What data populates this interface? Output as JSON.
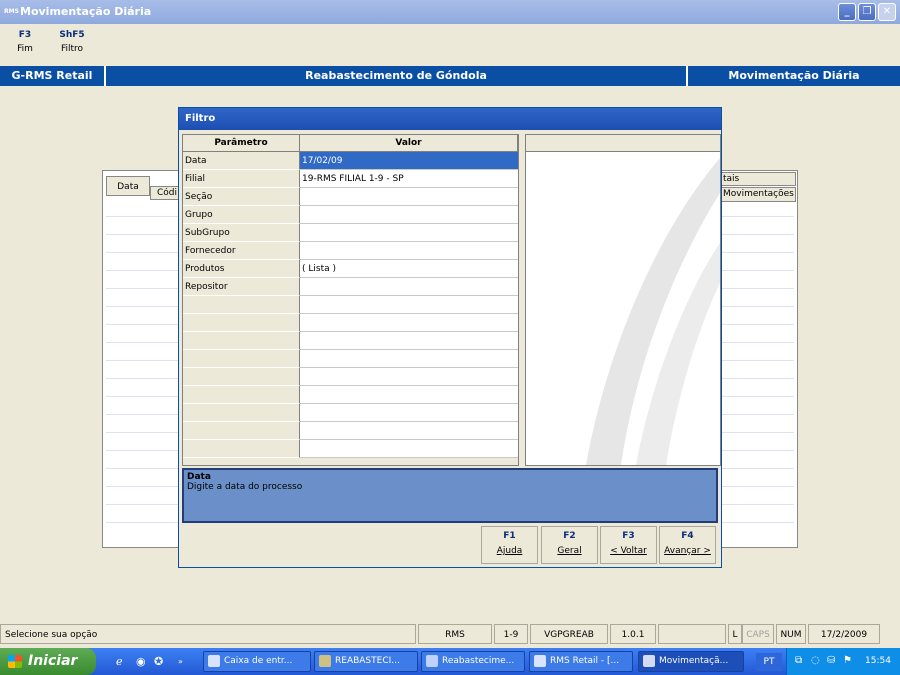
{
  "window": {
    "title": "Movimentação Diária",
    "app_badge": "RMS"
  },
  "function_keys": [
    {
      "key": "F3",
      "label": "Fim"
    },
    {
      "key": "ShF5",
      "label": "Filtro"
    }
  ],
  "header": {
    "left": "G-RMS Retail",
    "center": "Reabastecimento de Góndola",
    "right": "Movimentação Diária"
  },
  "background_table": {
    "col_data": "Data",
    "col_codigo": "Códi",
    "totais": "tais",
    "movimentacoes": "Movimentações"
  },
  "dialog": {
    "title": "Filtro",
    "columns": {
      "param": "Parâmetro",
      "value": "Valor"
    },
    "rows": [
      {
        "param": "Data",
        "value": "17/02/09"
      },
      {
        "param": "Filial",
        "value": "19-RMS FILIAL 1-9 - SP"
      },
      {
        "param": "Seção",
        "value": ""
      },
      {
        "param": "Grupo",
        "value": ""
      },
      {
        "param": "SubGrupo",
        "value": ""
      },
      {
        "param": "Fornecedor",
        "value": ""
      },
      {
        "param": "Produtos",
        "value": "( Lista )"
      },
      {
        "param": "Repositor",
        "value": ""
      }
    ],
    "help": {
      "title": "Data",
      "text": "Digite a data do processo"
    },
    "buttons": [
      {
        "key": "F1",
        "label": "Ajuda"
      },
      {
        "key": "F2",
        "label": "Geral"
      },
      {
        "key": "F3",
        "label": "< Voltar"
      },
      {
        "key": "F4",
        "label": "Avançar >"
      }
    ]
  },
  "status_bar": {
    "message": "Selecione sua opção",
    "system": "RMS",
    "filial": "1-9",
    "program": "VGPGREAB",
    "version": "1.0.1",
    "l": "L",
    "caps": "CAPS",
    "num": "NUM",
    "date": "17/2/2009"
  },
  "taskbar": {
    "start": "Iniciar",
    "tasks": [
      "Caixa de entr...",
      "REABASTECI...",
      "Reabastecime...",
      "RMS Retail - [...",
      "Movimentaçã..."
    ],
    "lang": "PT",
    "clock": "15:54"
  },
  "colors": {
    "header": "#0a4fa3",
    "selection": "#316ac5",
    "help_bg": "#6a8fc9",
    "taskbar": "#2458d4"
  }
}
